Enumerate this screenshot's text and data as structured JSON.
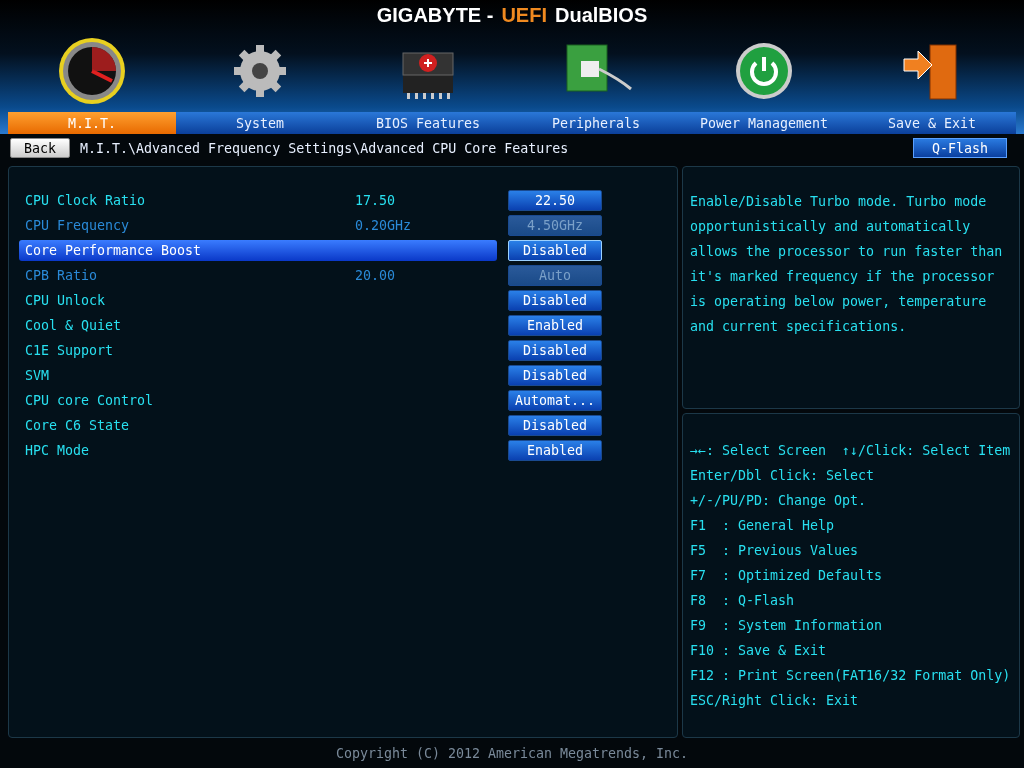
{
  "title": [
    {
      "text": "GIGABYTE -",
      "highlight": false
    },
    {
      "text": "UEFI",
      "highlight": true
    },
    {
      "text": "DualBIOS",
      "highlight": false
    }
  ],
  "tabs": [
    {
      "label": "M.I.T.",
      "selected": true
    },
    {
      "label": "System",
      "selected": false
    },
    {
      "label": "BIOS Features",
      "selected": false
    },
    {
      "label": "Peripherals",
      "selected": false
    },
    {
      "label": "Power Management",
      "selected": false
    },
    {
      "label": "Save & Exit",
      "selected": false
    }
  ],
  "back_button": "Back",
  "breadcrumb": "M.I.T.\\Advanced Frequency Settings\\Advanced CPU Core Features",
  "qflash_button": "Q-Flash",
  "settings": [
    {
      "label": "CPU Clock Ratio",
      "current": "17.50",
      "value": "22.50",
      "disabled": false,
      "selected": false
    },
    {
      "label": "CPU Frequency",
      "current": "0.20GHz",
      "value": "4.50GHz",
      "disabled": true,
      "selected": false
    },
    {
      "label": "Core Performance Boost",
      "value": "Disabled",
      "disabled": false,
      "selected": true
    },
    {
      "label": "CPB Ratio",
      "current": "20.00",
      "value": "Auto",
      "disabled": true,
      "selected": false
    },
    {
      "label": "CPU Unlock",
      "value": "Disabled",
      "disabled": false,
      "selected": false
    },
    {
      "label": "Cool & Quiet",
      "value": "Enabled",
      "disabled": false,
      "selected": false
    },
    {
      "label": "C1E Support",
      "value": "Disabled",
      "disabled": false,
      "selected": false
    },
    {
      "label": "SVM",
      "value": "Disabled",
      "disabled": false,
      "selected": false
    },
    {
      "label": "CPU core Control",
      "value": "Automat...",
      "disabled": false,
      "selected": false
    },
    {
      "label": "Core C6 State",
      "value": "Disabled",
      "disabled": false,
      "selected": false
    },
    {
      "label": "HPC Mode",
      "value": "Enabled",
      "disabled": false,
      "selected": false
    }
  ],
  "help_text": "Enable/Disable Turbo mode. Turbo mode opportunistically and automatically allows the processor to run faster than it's marked frequency if the processor is operating below power, temperature and current specifications.",
  "key_help": [
    [
      "→←: Select Screen",
      "↑↓/Click: Select Item"
    ],
    [
      "Enter/Dbl Click: Select"
    ],
    [
      "+/-/PU/PD: Change Opt."
    ],
    [
      "F1  : General Help"
    ],
    [
      "F5  : Previous Values"
    ],
    [
      "F7  : Optimized Defaults"
    ],
    [
      "F8  : Q-Flash"
    ],
    [
      "F9  : System Information"
    ],
    [
      "F10 : Save & Exit"
    ],
    [
      "F12 : Print Screen(FAT16/32 Format Only)"
    ],
    [
      "ESC/Right Click: Exit"
    ]
  ],
  "copyright": "Copyright (C) 2012 American Megatrends, Inc."
}
